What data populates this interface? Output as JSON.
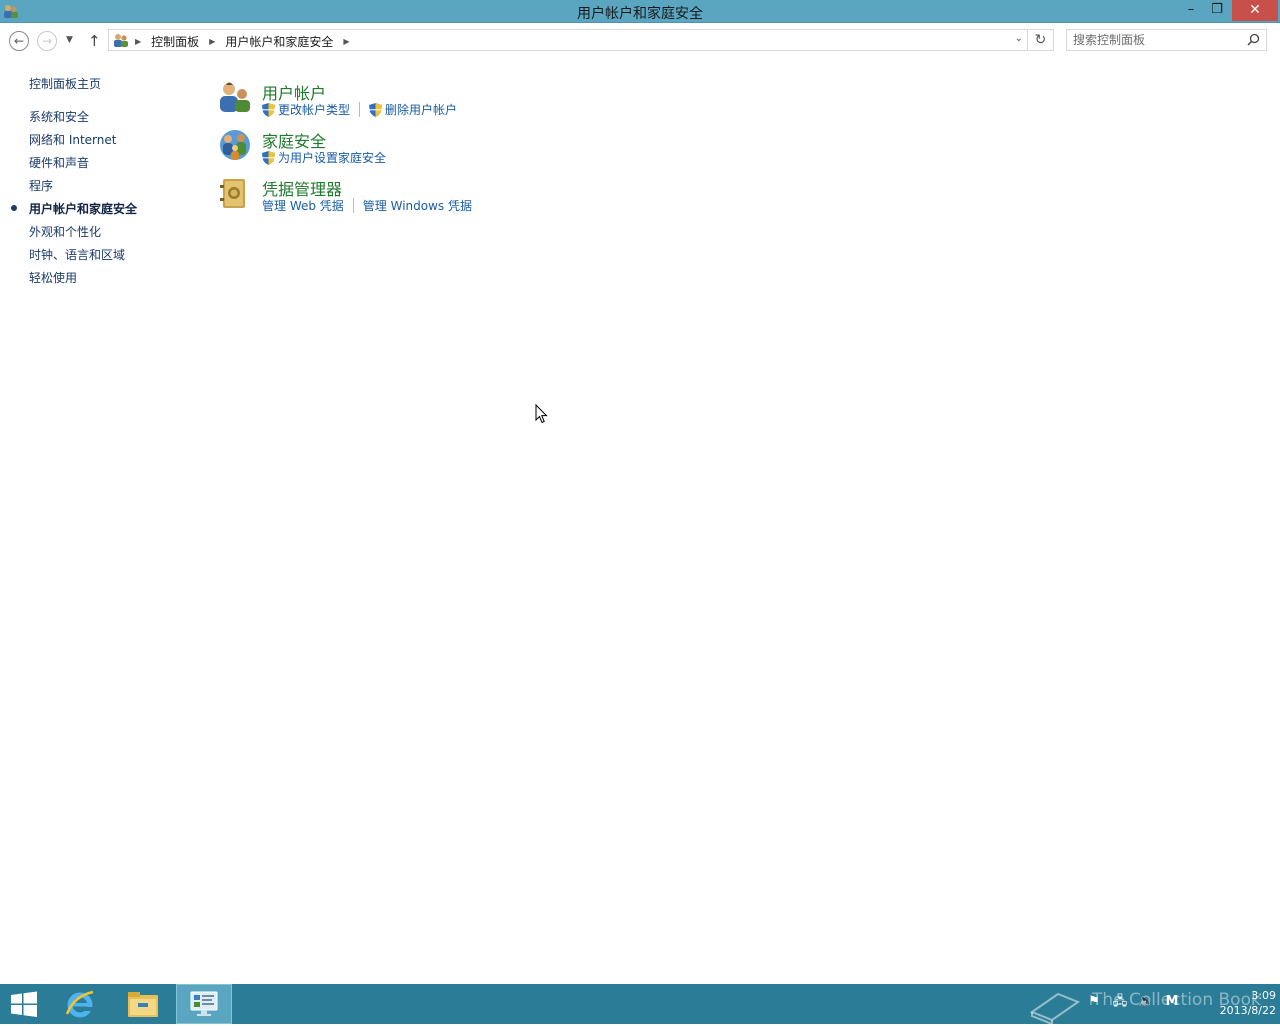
{
  "window": {
    "title": "用户帐户和家庭安全",
    "minimize_glyph": "–",
    "restore_glyph": "❐",
    "close_glyph": "✕"
  },
  "address": {
    "crumbs": [
      "控制面板",
      "用户帐户和家庭安全"
    ],
    "search_placeholder": "搜索控制面板"
  },
  "leftnav": {
    "home": "控制面板主页",
    "items": [
      "系统和安全",
      "网络和 Internet",
      "硬件和声音",
      "程序",
      "用户帐户和家庭安全",
      "外观和个性化",
      "时钟、语言和区域",
      "轻松使用"
    ],
    "active_index": 4
  },
  "categories": [
    {
      "title": "用户帐户",
      "icon": "user-accounts-icon",
      "links": [
        "更改帐户类型",
        "删除用户帐户"
      ]
    },
    {
      "title": "家庭安全",
      "icon": "family-safety-icon",
      "links": [
        "为用户设置家庭安全"
      ]
    },
    {
      "title": "凭据管理器",
      "icon": "credential-manager-icon",
      "links": [
        "管理 Web 凭据",
        "管理 Windows 凭据"
      ]
    }
  ],
  "taskbar": {
    "apps": [
      "start-icon",
      "internet-explorer-icon",
      "file-explorer-icon",
      "control-panel-icon"
    ],
    "watermark": "The Collection Book",
    "time": "3:09",
    "date": "2013/8/22"
  },
  "colors": {
    "titlebar": "#5aa6c1",
    "taskbar": "#2b7c97",
    "category_title": "#1f7a2c",
    "task_link": "#1a5ca6",
    "nav_link": "#1a3a6b"
  }
}
